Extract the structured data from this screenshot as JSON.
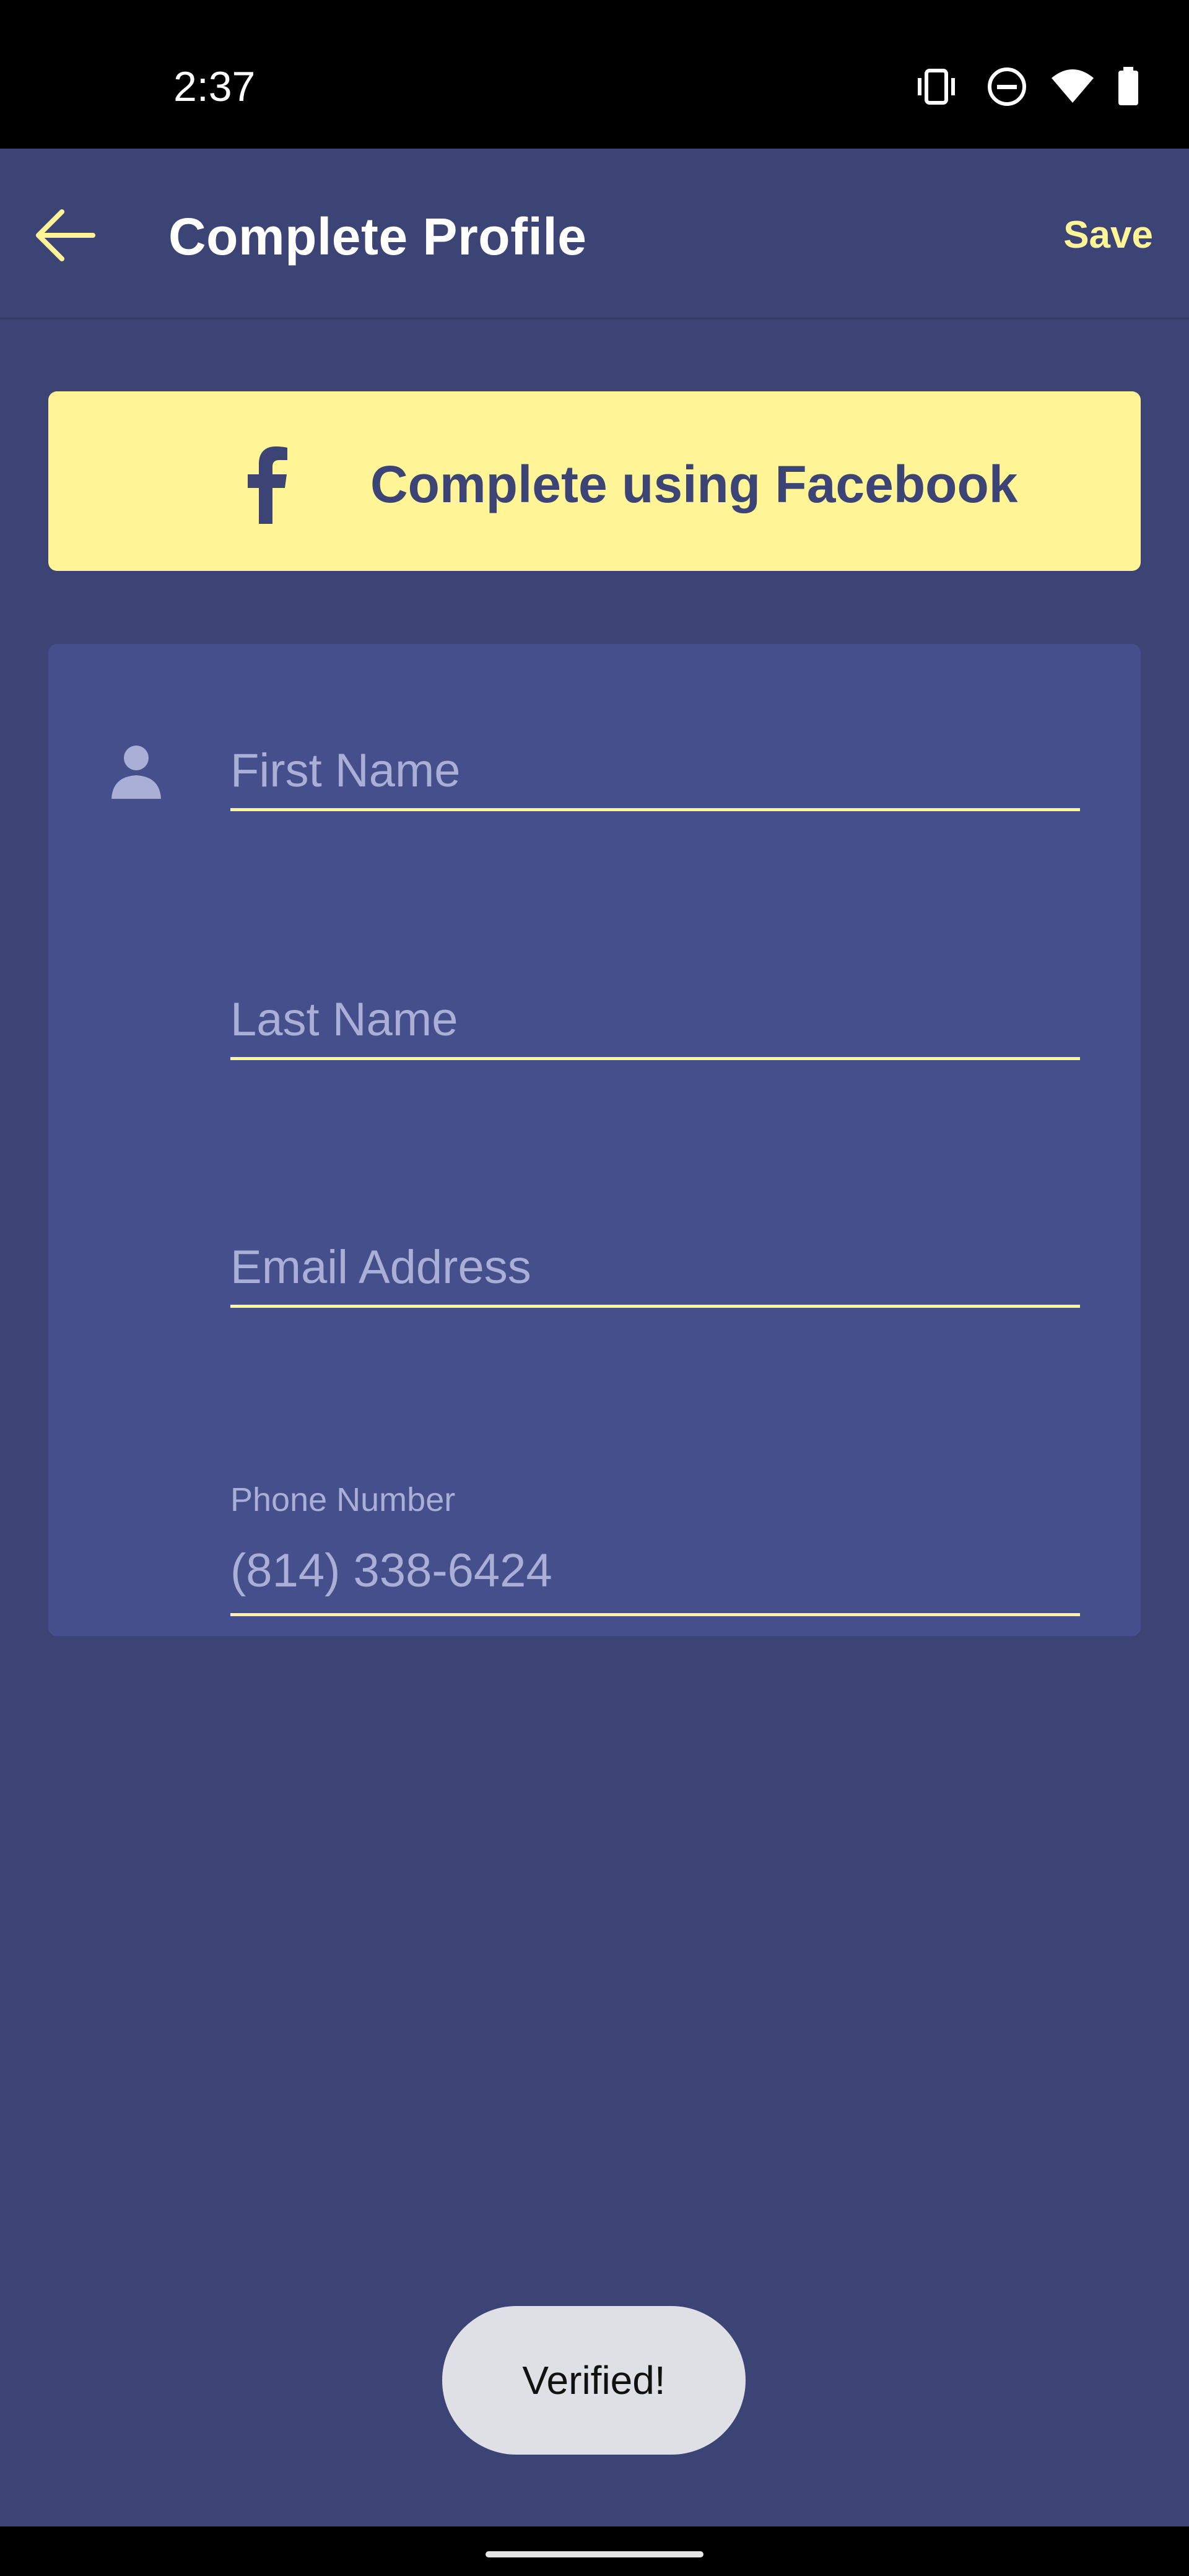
{
  "status_bar": {
    "time": "2:37",
    "icons": [
      "vibrate-icon",
      "do-not-disturb-icon",
      "wifi-icon",
      "battery-icon"
    ]
  },
  "app_bar": {
    "back_icon": "arrow-left-icon",
    "title": "Complete Profile",
    "save_label": "Save"
  },
  "facebook_button": {
    "icon": "facebook-icon",
    "label": "Complete using Facebook"
  },
  "form": {
    "icon": "person-icon",
    "first_name": {
      "placeholder": "First Name",
      "value": ""
    },
    "last_name": {
      "placeholder": "Last Name",
      "value": ""
    },
    "email": {
      "placeholder": "Email Address",
      "value": ""
    },
    "phone": {
      "label": "Phone Number",
      "value": "(814) 338-6424"
    }
  },
  "toast": {
    "text": "Verified!"
  },
  "colors": {
    "background": "#3c4375",
    "card": "#454f8b",
    "accent_yellow": "#fff597",
    "placeholder": "#a9afd6"
  }
}
